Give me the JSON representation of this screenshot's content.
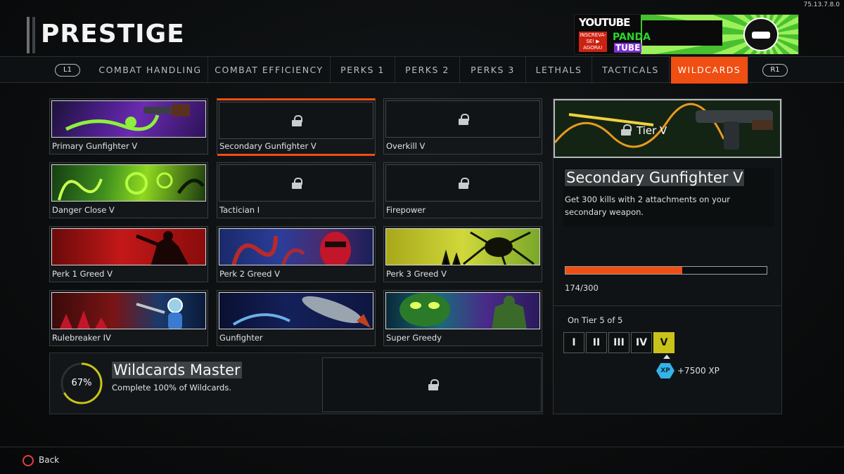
{
  "version": "75.13.7.8.0",
  "page_title": "PRESTIGE",
  "banner": {
    "line1": "YOUTUBE",
    "subscribe": "INSCREVA-SE! ▶ AGORA!",
    "brand1": "PANDA",
    "brand2": "TUBE"
  },
  "nav": {
    "left_button": "L1",
    "right_button": "R1",
    "tabs": [
      {
        "label": "COMBAT HANDLING"
      },
      {
        "label": "COMBAT EFFICIENCY"
      },
      {
        "label": "PERKS 1"
      },
      {
        "label": "PERKS 2"
      },
      {
        "label": "PERKS 3"
      },
      {
        "label": "LETHALS"
      },
      {
        "label": "TACTICALS"
      },
      {
        "label": "WILDCARDS",
        "active": true
      }
    ]
  },
  "cards": [
    {
      "label": "Primary Gunfighter V",
      "locked": false,
      "art": "primary-gunfighter"
    },
    {
      "label": "Secondary Gunfighter V",
      "locked": true,
      "selected": true
    },
    {
      "label": "Overkill V",
      "locked": true
    },
    {
      "label": "Danger Close V",
      "locked": false,
      "art": "danger-close"
    },
    {
      "label": "Tactician I",
      "locked": true
    },
    {
      "label": "Firepower",
      "locked": true
    },
    {
      "label": "Perk 1 Greed V",
      "locked": false,
      "art": "perk1-greed"
    },
    {
      "label": "Perk 2 Greed V",
      "locked": false,
      "art": "perk2-greed"
    },
    {
      "label": "Perk 3 Greed V",
      "locked": false,
      "art": "perk3-greed"
    },
    {
      "label": "Rulebreaker IV",
      "locked": false,
      "art": "rulebreaker"
    },
    {
      "label": "Gunfighter",
      "locked": false,
      "art": "gunfighter"
    },
    {
      "label": "Super Greedy",
      "locked": false,
      "art": "super-greedy"
    }
  ],
  "master": {
    "percent_text": "67%",
    "percent": 0.67,
    "title": "Wildcards Master",
    "description": "Complete 100% of Wildcards.",
    "icon": "lock-icon"
  },
  "detail": {
    "tier_label": "Tier V",
    "title": "Secondary Gunfighter V",
    "description": "Get 300 kills with 2 attachments on your secondary weapon.",
    "progress_text": "174/300",
    "progress": 0.58,
    "tier_status": "On Tier 5 of 5",
    "tiers": [
      "I",
      "II",
      "III",
      "IV",
      "V"
    ],
    "current_tier_index": 4,
    "xp_icon": "XP",
    "xp_reward": "+7500 XP"
  },
  "footer": {
    "back_label": "Back",
    "back_icon": "circle-button-icon"
  },
  "colors": {
    "accent": "#f04e12",
    "tier_highlight": "#c9c21a",
    "xp_icon": "#33b3e8",
    "back_icon": "#e04040"
  }
}
